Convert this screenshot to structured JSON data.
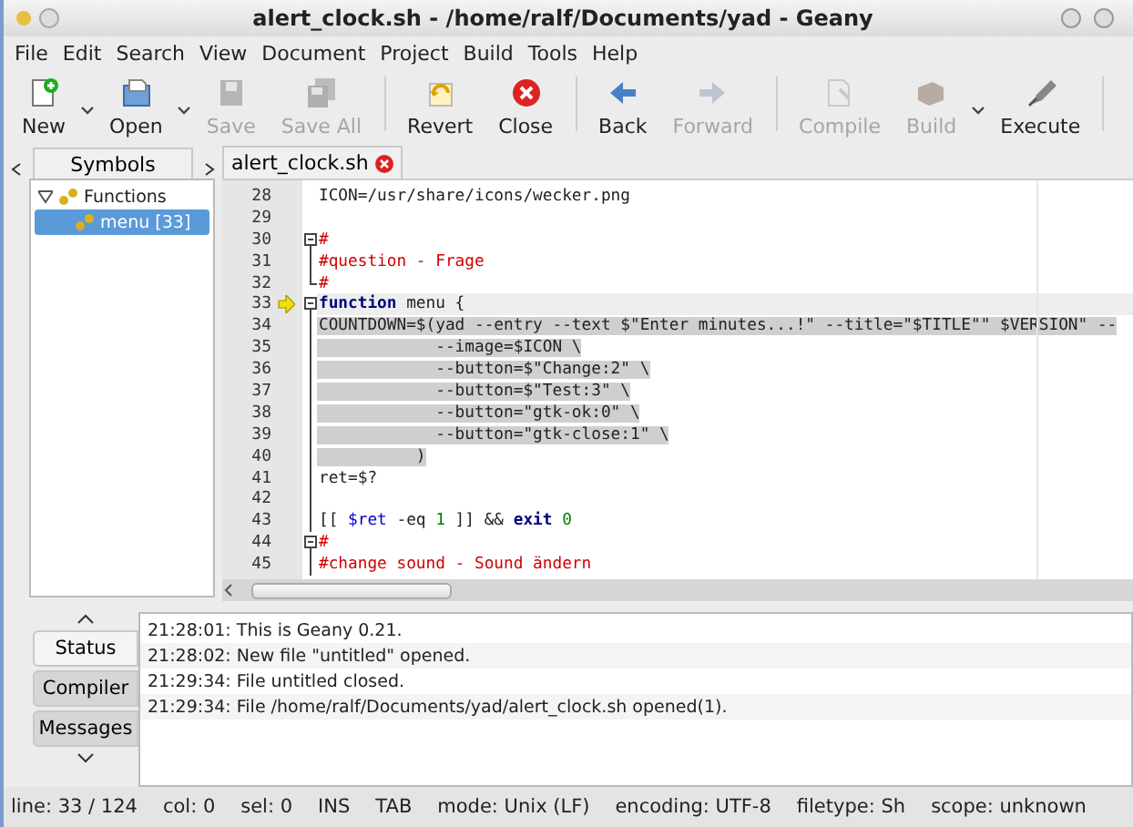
{
  "window": {
    "title": "alert_clock.sh - /home/ralf/Documents/yad - Geany"
  },
  "menu": [
    "File",
    "Edit",
    "Search",
    "View",
    "Document",
    "Project",
    "Build",
    "Tools",
    "Help"
  ],
  "toolbar": [
    [
      {
        "kind": "new",
        "label": "New",
        "disabled": false,
        "dropdown": true
      },
      {
        "kind": "open",
        "label": "Open",
        "disabled": false,
        "dropdown": true
      },
      {
        "kind": "save",
        "label": "Save",
        "disabled": true,
        "dropdown": false
      },
      {
        "kind": "saveall",
        "label": "Save All",
        "disabled": true,
        "dropdown": false
      }
    ],
    [
      {
        "kind": "revert",
        "label": "Revert",
        "disabled": false,
        "dropdown": false
      },
      {
        "kind": "close",
        "label": "Close",
        "disabled": false,
        "dropdown": false
      }
    ],
    [
      {
        "kind": "back",
        "label": "Back",
        "disabled": false,
        "dropdown": false
      },
      {
        "kind": "forward",
        "label": "Forward",
        "disabled": true,
        "dropdown": false
      }
    ],
    [
      {
        "kind": "compile",
        "label": "Compile",
        "disabled": true,
        "dropdown": false
      },
      {
        "kind": "build",
        "label": "Build",
        "disabled": true,
        "dropdown": true
      },
      {
        "kind": "execute",
        "label": "Execute",
        "disabled": false,
        "dropdown": false
      }
    ]
  ],
  "sidebar": {
    "tabs": [
      {
        "label": "Symbols",
        "selected": true
      }
    ],
    "tree": [
      {
        "label": "Functions",
        "expanded": true,
        "selected": false,
        "children": [
          {
            "label": "menu [33]",
            "selected": true
          }
        ]
      }
    ]
  },
  "editor": {
    "tabs": [
      {
        "label": "alert_clock.sh",
        "selected": true
      }
    ],
    "lines": [
      {
        "no": "28",
        "kind": "plain",
        "current": false,
        "marker": false,
        "selected": false,
        "segments": [
          {
            "kind": "plain",
            "t": "ICON=/usr/share/icons/wecker.png"
          }
        ]
      },
      {
        "no": "29",
        "kind": "plain",
        "current": false,
        "marker": false
      },
      {
        "no": "30",
        "kind": "foldstart",
        "current": false,
        "marker": false,
        "selected": false,
        "segments": [
          {
            "kind": "comment",
            "t": "#"
          }
        ]
      },
      {
        "no": "31",
        "kind": "foldbody",
        "current": false,
        "marker": false,
        "selected": false,
        "segments": [
          {
            "kind": "comment",
            "t": "#question - Frage"
          }
        ]
      },
      {
        "no": "32",
        "kind": "foldend",
        "current": false,
        "marker": false,
        "selected": false,
        "segments": [
          {
            "kind": "comment",
            "t": "#"
          }
        ]
      },
      {
        "no": "33",
        "kind": "foldstart",
        "current": true,
        "marker": true,
        "selected": false,
        "segments": [
          {
            "kind": "keyword",
            "t": "function"
          },
          {
            "kind": "plain",
            "t": " menu {"
          }
        ]
      },
      {
        "no": "34",
        "kind": "foldbody",
        "current": false,
        "marker": false,
        "selected": true,
        "segments": [
          {
            "kind": "plain",
            "t": "COUNTDOWN=$(yad --entry --text $\"Enter minutes...!\" --title=\"$TITLE\"\" $VERSION\" --"
          }
        ]
      },
      {
        "no": "35",
        "kind": "foldbody",
        "current": false,
        "marker": false,
        "selected": true,
        "segments": [
          {
            "kind": "plain",
            "t": "            --image=$ICON \\"
          }
        ]
      },
      {
        "no": "36",
        "kind": "foldbody",
        "current": false,
        "marker": false,
        "selected": true,
        "segments": [
          {
            "kind": "plain",
            "t": "            --button=$\"Change:2\" \\"
          }
        ]
      },
      {
        "no": "37",
        "kind": "foldbody",
        "current": false,
        "marker": false,
        "selected": true,
        "segments": [
          {
            "kind": "plain",
            "t": "            --button=$\"Test:3\" \\"
          }
        ]
      },
      {
        "no": "38",
        "kind": "foldbody",
        "current": false,
        "marker": false,
        "selected": true,
        "segments": [
          {
            "kind": "plain",
            "t": "            --button=\"gtk-ok:0\" \\"
          }
        ]
      },
      {
        "no": "39",
        "kind": "foldbody",
        "current": false,
        "marker": false,
        "selected": true,
        "segments": [
          {
            "kind": "plain",
            "t": "            --button=\"gtk-close:1\" \\"
          }
        ]
      },
      {
        "no": "40",
        "kind": "foldbody",
        "current": false,
        "marker": false,
        "selected": true,
        "segments": [
          {
            "kind": "plain",
            "t": "          )"
          }
        ]
      },
      {
        "no": "41",
        "kind": "foldbody",
        "current": false,
        "marker": false,
        "selected": false,
        "segments": [
          {
            "kind": "plain",
            "t": "ret=$?"
          }
        ]
      },
      {
        "no": "42",
        "kind": "foldbody",
        "current": false,
        "marker": false
      },
      {
        "no": "43",
        "kind": "foldbody",
        "current": false,
        "marker": false,
        "selected": false,
        "segments": [
          {
            "kind": "plain",
            "t": "[[ "
          },
          {
            "kind": "variable",
            "t": "$ret"
          },
          {
            "kind": "plain",
            "t": " -eq "
          },
          {
            "kind": "number",
            "t": "1"
          },
          {
            "kind": "plain",
            "t": " ]] && "
          },
          {
            "kind": "keyword",
            "t": "exit"
          },
          {
            "kind": "number",
            "t": " 0"
          }
        ]
      },
      {
        "no": "44",
        "kind": "foldstart",
        "current": false,
        "marker": false,
        "selected": false,
        "segments": [
          {
            "kind": "comment",
            "t": "#"
          }
        ]
      },
      {
        "no": "45",
        "kind": "foldbody",
        "current": false,
        "marker": false,
        "selected": false,
        "segments": [
          {
            "kind": "comment",
            "t": "#change sound - Sound ändern"
          }
        ]
      }
    ]
  },
  "messages": {
    "tabs": [
      {
        "label": "Status",
        "selected": true
      },
      {
        "label": "Compiler",
        "selected": false
      },
      {
        "label": "Messages",
        "selected": false
      }
    ],
    "rows": [
      "21:28:01: This is Geany 0.21.",
      "21:28:02: New file \"untitled\" opened.",
      "21:29:34: File untitled closed.",
      "21:29:34: File /home/ralf/Documents/yad/alert_clock.sh opened(1)."
    ]
  },
  "status_bar": [
    "line: 33 / 124",
    "col: 0",
    "sel: 0",
    "INS",
    "TAB",
    "mode: Unix (LF)",
    "encoding: UTF-8",
    "filetype: Sh",
    "scope: unknown"
  ]
}
